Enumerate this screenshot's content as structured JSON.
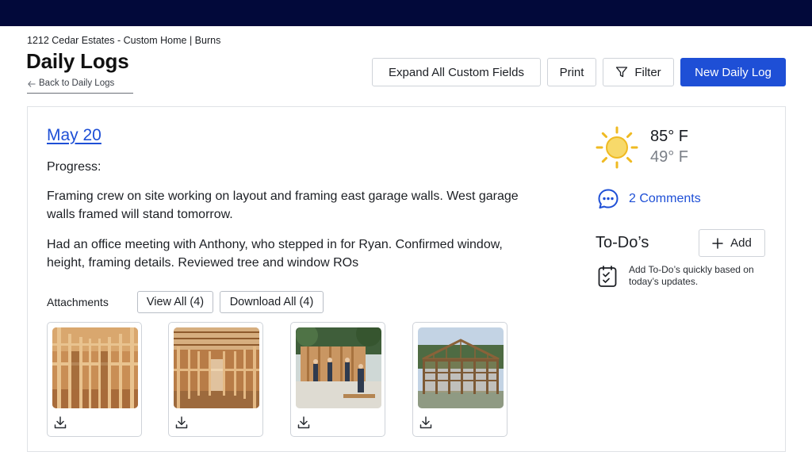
{
  "header": {
    "breadcrumb": "1212 Cedar Estates - Custom Home | Burns",
    "title": "Daily Logs",
    "back_link": "Back to Daily Logs"
  },
  "toolbar": {
    "expand_label": "Expand All Custom Fields",
    "print_label": "Print",
    "filter_label": "Filter",
    "new_label": "New Daily Log"
  },
  "log": {
    "date": "May 20",
    "progress_label": "Progress:",
    "notes": [
      "Framing crew on site working on layout and framing east garage walls. West garage walls framed will stand tomorrow.",
      "Had an office meeting with Anthony, who stepped in for Ryan. Confirmed window, height, framing details. Reviewed tree and window ROs"
    ],
    "attachments_label": "Attachments",
    "view_all": "View All (4)",
    "download_all": "Download All (4)",
    "attachments": [
      {
        "icon": "download-icon"
      },
      {
        "icon": "download-icon"
      },
      {
        "icon": "download-icon"
      },
      {
        "icon": "download-icon"
      }
    ]
  },
  "weather": {
    "icon": "sun-icon",
    "high": "85° F",
    "low": "49° F"
  },
  "comments": {
    "icon": "comment-bubble-icon",
    "label": "2 Comments"
  },
  "todos": {
    "title": "To-Do’s",
    "add_label": "Add",
    "hint": "Add To-Do’s quickly based on today’s updates.",
    "hint_icon": "clipboard-check-icon"
  },
  "colors": {
    "topbar": "#02093a",
    "accent": "#1e4fd6",
    "sun": "#f2c230"
  }
}
